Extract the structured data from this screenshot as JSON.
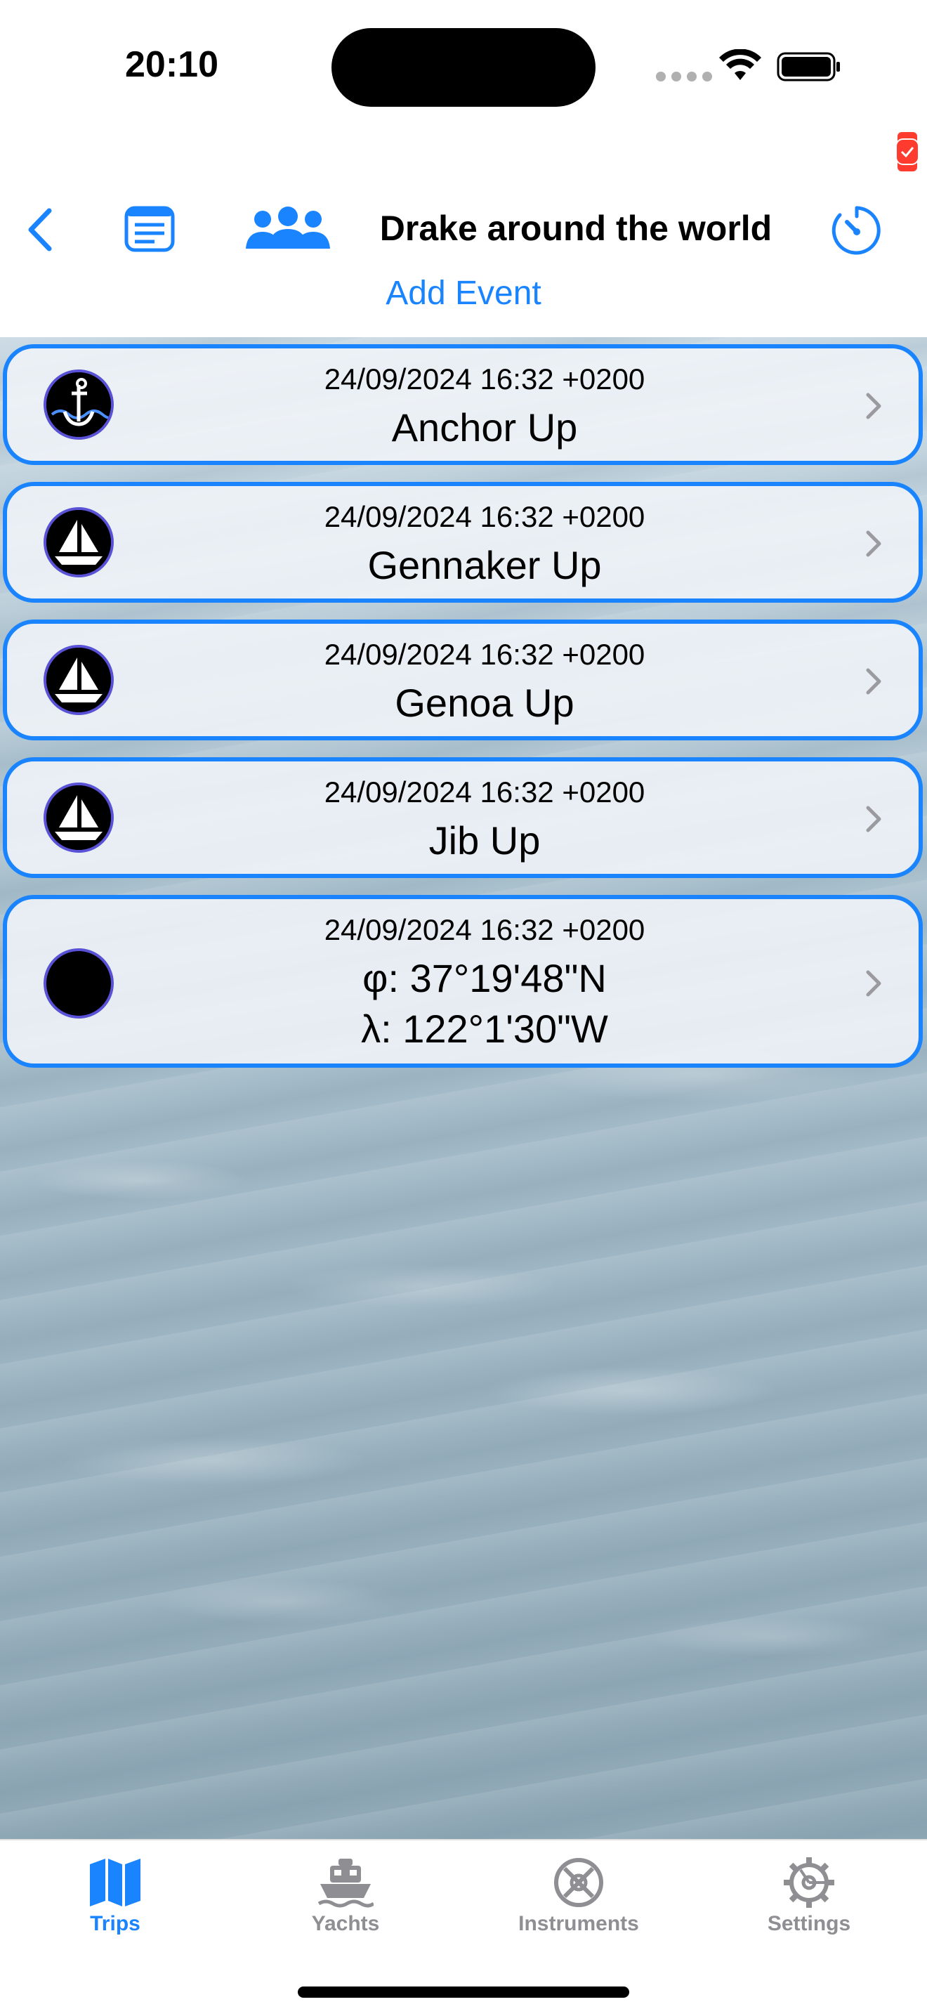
{
  "status_bar": {
    "time": "20:10"
  },
  "nav": {
    "title": "Drake around the world",
    "add_event_label": "Add Event",
    "accent_color": "#1a84ff"
  },
  "events": [
    {
      "datetime": "24/09/2024  16:32 +0200",
      "title": "Anchor Up",
      "icon": "anchor-icon"
    },
    {
      "datetime": "24/09/2024  16:32 +0200",
      "title": "Gennaker Up",
      "icon": "sailboat-icon"
    },
    {
      "datetime": "24/09/2024  16:32 +0200",
      "title": "Genoa Up",
      "icon": "sailboat-icon"
    },
    {
      "datetime": "24/09/2024  16:32 +0200",
      "title": "Jib Up",
      "icon": "sailboat-icon"
    },
    {
      "datetime": "24/09/2024  16:32 +0200",
      "lat": "φ: 37°19'48\"N",
      "lon": "λ: 122°1'30\"W",
      "icon": "position-icon"
    }
  ],
  "tabs": [
    {
      "label": "Trips",
      "icon": "map-icon",
      "active": true
    },
    {
      "label": "Yachts",
      "icon": "ship-icon",
      "active": false
    },
    {
      "label": "Instruments",
      "icon": "compass-icon",
      "active": false
    },
    {
      "label": "Settings",
      "icon": "gear-icon",
      "active": false
    }
  ]
}
